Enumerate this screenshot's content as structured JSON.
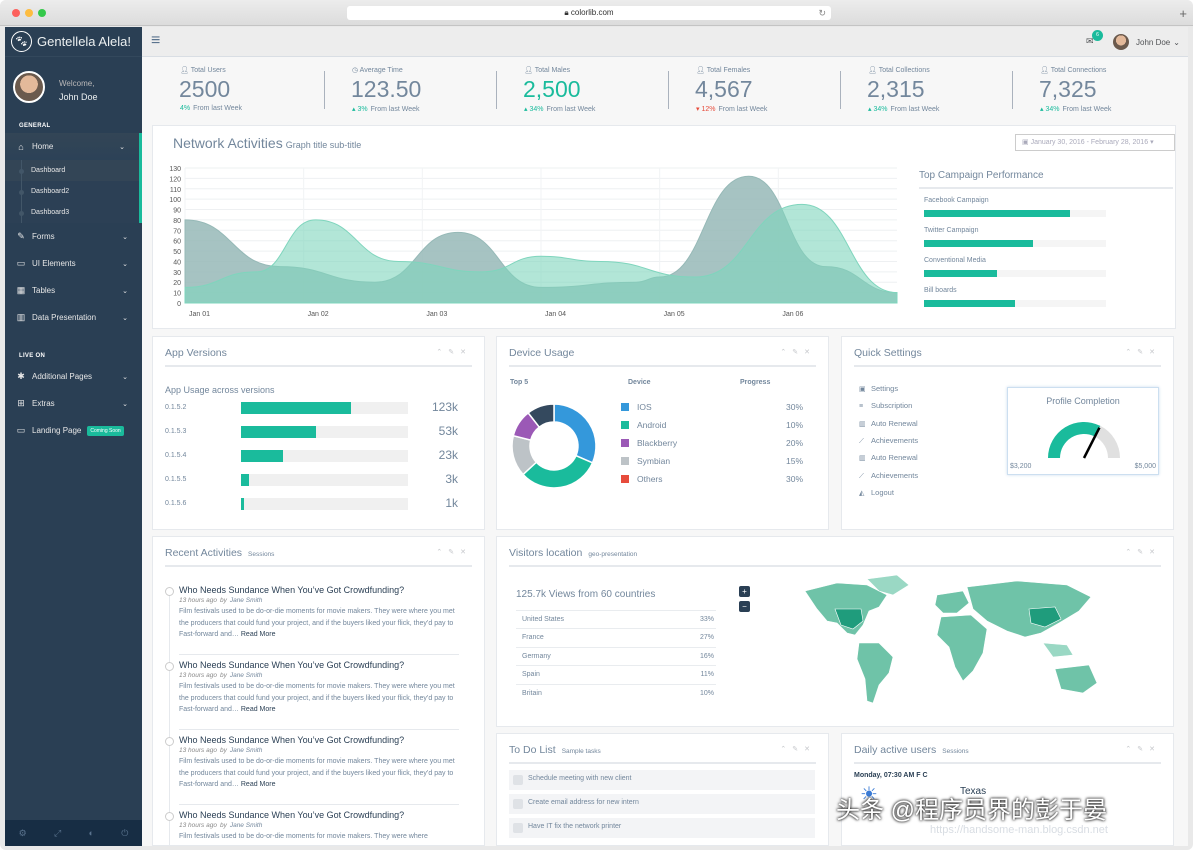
{
  "browser": {
    "url": "colorlib.com"
  },
  "sidebar": {
    "brand": "Gentellela Alela!",
    "welcome": "Welcome,",
    "user_name": "John Doe",
    "section_general": "GENERAL",
    "section_live": "LIVE ON",
    "items": [
      {
        "label": "Home"
      },
      {
        "label": "Forms"
      },
      {
        "label": "UI Elements"
      },
      {
        "label": "Tables"
      },
      {
        "label": "Data Presentation"
      }
    ],
    "home_sub": [
      "Dashboard",
      "Dashboard2",
      "Dashboard3"
    ],
    "live_items": [
      {
        "label": "Additional Pages"
      },
      {
        "label": "Extras"
      },
      {
        "label": "Landing Page",
        "badge": "Coming Soon"
      }
    ]
  },
  "topnav": {
    "mail_count": "6",
    "user": "John Doe"
  },
  "tiles": [
    {
      "label": "Total Users",
      "value": "2500",
      "change": "4%",
      "suffix": "From last Week",
      "green": false,
      "dir": ""
    },
    {
      "label": "Average Time",
      "value": "123.50",
      "change": "3%",
      "suffix": "From last Week",
      "green": false,
      "dir": "up"
    },
    {
      "label": "Total Males",
      "value": "2,500",
      "change": "34%",
      "suffix": "From last Week",
      "green": true,
      "dir": "up"
    },
    {
      "label": "Total Females",
      "value": "4,567",
      "change": "12%",
      "suffix": "From last Week",
      "green": false,
      "dir": "down"
    },
    {
      "label": "Total Collections",
      "value": "2,315",
      "change": "34%",
      "suffix": "From last Week",
      "green": false,
      "dir": "up"
    },
    {
      "label": "Total Connections",
      "value": "7,325",
      "change": "34%",
      "suffix": "From last Week",
      "green": false,
      "dir": "up"
    }
  ],
  "network": {
    "title": "Network Activities",
    "subtitle": "Graph title sub-title",
    "date_range": "January 30, 2016 - February 28, 2016",
    "campaign_title": "Top Campaign Performance",
    "campaigns": [
      {
        "label": "Facebook Campaign",
        "progress": 0.8
      },
      {
        "label": "Twitter Campaign",
        "progress": 0.6
      },
      {
        "label": "Conventional Media",
        "progress": 0.4
      },
      {
        "label": "Bill boards",
        "progress": 0.5
      }
    ]
  },
  "chart_data": {
    "type": "area",
    "x": [
      "Jan 01",
      "Jan 02",
      "Jan 03",
      "Jan 04",
      "Jan 05",
      "Jan 06"
    ],
    "ylim": [
      0,
      130
    ],
    "yticks": [
      130,
      120,
      110,
      100,
      90,
      80,
      70,
      60,
      50,
      40,
      30,
      20,
      10,
      0
    ],
    "series": [
      {
        "color": "#96b9b7",
        "points": [
          [
            0,
            80
          ],
          [
            0.8,
            35
          ],
          [
            1.6,
            20
          ],
          [
            2.3,
            68
          ],
          [
            3.0,
            15
          ],
          [
            3.8,
            20
          ],
          [
            4.0,
            25
          ],
          [
            4.75,
            122
          ],
          [
            5.4,
            35
          ],
          [
            6.0,
            10
          ]
        ]
      },
      {
        "color": "#7fd5bd",
        "points": [
          [
            0,
            15
          ],
          [
            0.6,
            30
          ],
          [
            1.1,
            80
          ],
          [
            1.8,
            40
          ],
          [
            2.5,
            30
          ],
          [
            3.0,
            45
          ],
          [
            3.5,
            40
          ],
          [
            4.3,
            25
          ],
          [
            5.2,
            95
          ],
          [
            6.0,
            10
          ]
        ]
      }
    ],
    "grid": true
  },
  "app_versions": {
    "title": "App Versions",
    "subtitle": "App Usage across versions",
    "rows": [
      {
        "v": "0.1.5.2",
        "n": "123k",
        "pct": 0.66
      },
      {
        "v": "0.1.5.3",
        "n": "53k",
        "pct": 0.45
      },
      {
        "v": "0.1.5.4",
        "n": "23k",
        "pct": 0.25
      },
      {
        "v": "0.1.5.5",
        "n": "3k",
        "pct": 0.05
      },
      {
        "v": "0.1.5.6",
        "n": "1k",
        "pct": 0.02
      }
    ]
  },
  "device_usage": {
    "title": "Device Usage",
    "col_top": "Top 5",
    "col_device": "Device",
    "col_progress": "Progress",
    "rows": [
      {
        "name": "IOS",
        "pct": "30%",
        "color": "#3498db"
      },
      {
        "name": "Android",
        "pct": "10%",
        "color": "#1abb9c"
      },
      {
        "name": "Blackberry",
        "pct": "20%",
        "color": "#9b59b6"
      },
      {
        "name": "Symbian",
        "pct": "15%",
        "color": "#bdc3c7"
      },
      {
        "name": "Others",
        "pct": "30%",
        "color": "#e74c3c"
      }
    ],
    "donut": [
      {
        "color": "#3498db",
        "value": 30
      },
      {
        "color": "#1abb9c",
        "value": 30
      },
      {
        "color": "#bdc3c7",
        "value": 15
      },
      {
        "color": "#9b59b6",
        "value": 10
      },
      {
        "color": "#34495e",
        "value": 10
      }
    ]
  },
  "quick_settings": {
    "title": "Quick Settings",
    "items": [
      {
        "icon": "calendar-icon",
        "glyph": "▣",
        "label": "Settings"
      },
      {
        "icon": "list-icon",
        "glyph": "≡",
        "label": "Subscription"
      },
      {
        "icon": "bar-chart-icon",
        "glyph": "▥",
        "label": "Auto Renewal"
      },
      {
        "icon": "line-chart-icon",
        "glyph": "⟋",
        "label": "Achievements"
      },
      {
        "icon": "bar-chart-icon",
        "glyph": "▥",
        "label": "Auto Renewal"
      },
      {
        "icon": "line-chart-icon",
        "glyph": "⟋",
        "label": "Achievements"
      },
      {
        "icon": "area-chart-icon",
        "glyph": "◭",
        "label": "Logout"
      }
    ],
    "profile_title": "Profile Completion",
    "gauge_min": "$3,200",
    "gauge_max": "$5,000",
    "gauge_level": 0.65
  },
  "recent_activities": {
    "title": "Recent Activities",
    "subtitle": "Sessions",
    "items": [
      {
        "title": "Who Needs Sundance When You’ve Got Crowdfunding?",
        "time": "13 hours ago",
        "by": "by",
        "author": "Jane Smith",
        "excerpt": "Film festivals used to be do-or-die moments for movie makers. They were where you met the producers that could fund your project, and if the buyers liked your flick, they’d pay to Fast-forward and…",
        "more": "Read More"
      },
      {
        "title": "Who Needs Sundance When You’ve Got Crowdfunding?",
        "time": "13 hours ago",
        "by": "by",
        "author": "Jane Smith",
        "excerpt": "Film festivals used to be do-or-die moments for movie makers. They were where you met the producers that could fund your project, and if the buyers liked your flick, they’d pay to Fast-forward and…",
        "more": "Read More"
      },
      {
        "title": "Who Needs Sundance When You’ve Got Crowdfunding?",
        "time": "13 hours ago",
        "by": "by",
        "author": "Jane Smith",
        "excerpt": "Film festivals used to be do-or-die moments for movie makers. They were where you met the producers that could fund your project, and if the buyers liked your flick, they’d pay to Fast-forward and…",
        "more": "Read More"
      },
      {
        "title": "Who Needs Sundance When You’ve Got Crowdfunding?",
        "time": "13 hours ago",
        "by": "by",
        "author": "Jane Smith",
        "excerpt": "Film festivals used to be do-or-die moments for movie makers. They were where",
        "more": ""
      }
    ]
  },
  "visitors": {
    "title": "Visitors location",
    "subtitle": "geo-presentation",
    "views": "125.7k Views from 60 countries",
    "rows": [
      {
        "c": "United States",
        "p": "33%"
      },
      {
        "c": "France",
        "p": "27%"
      },
      {
        "c": "Germany",
        "p": "16%"
      },
      {
        "c": "Spain",
        "p": "11%"
      },
      {
        "c": "Britain",
        "p": "10%"
      }
    ],
    "zoom_in": "+",
    "zoom_out": "−"
  },
  "todo": {
    "title": "To Do List",
    "subtitle": "Sample tasks",
    "items": [
      "Schedule meeting with new client",
      "Create email address for new intern",
      "Have IT fix the network printer"
    ]
  },
  "daily": {
    "title": "Daily active users",
    "subtitle": "Sessions",
    "day": "Monday, 07:30 AM F C",
    "place": "Texas"
  },
  "watermark": {
    "main": "头条 @程序员界的彭于晏",
    "url": "https://handsome-man.blog.csdn.net"
  }
}
